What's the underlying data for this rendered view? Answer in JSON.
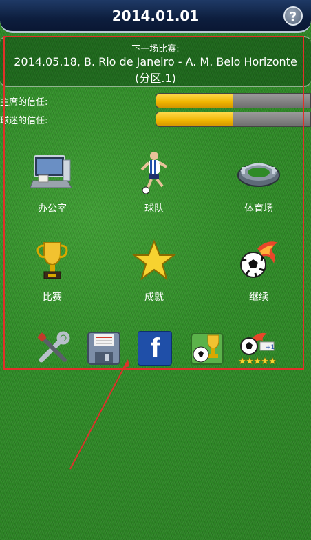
{
  "header": {
    "date": "2014.01.01",
    "help_icon": "help-question-icon",
    "help_glyph": "?"
  },
  "next_match": {
    "label": "下一场比赛:",
    "match": "2014.05.18, B. Rio de Janeiro - A. M. Belo Horizonte",
    "division": "(分区.1)"
  },
  "trust": [
    {
      "label": "主席的信任:",
      "level_percent": 50
    },
    {
      "label": "球迷的信任:",
      "level_percent": 50
    }
  ],
  "menu": [
    {
      "label": "办公室",
      "icon": "office-computer-icon"
    },
    {
      "label": "球队",
      "icon": "player-icon"
    },
    {
      "label": "体育场",
      "icon": "stadium-icon"
    },
    {
      "label": "比赛",
      "icon": "trophy-icon"
    },
    {
      "label": "成就",
      "icon": "star-icon"
    },
    {
      "label": "继续",
      "icon": "fire-ball-icon"
    }
  ],
  "tools": [
    {
      "icon": "settings-tools-icon"
    },
    {
      "icon": "save-disk-icon"
    },
    {
      "icon": "facebook-icon",
      "glyph": "f"
    },
    {
      "icon": "cup-icon"
    },
    {
      "icon": "rate-stars-icon"
    }
  ],
  "colors": {
    "trust_fill": "#f0b400",
    "highlight": "#e0302a",
    "facebook": "#1f4fa8",
    "header": "#0d1e3e"
  }
}
